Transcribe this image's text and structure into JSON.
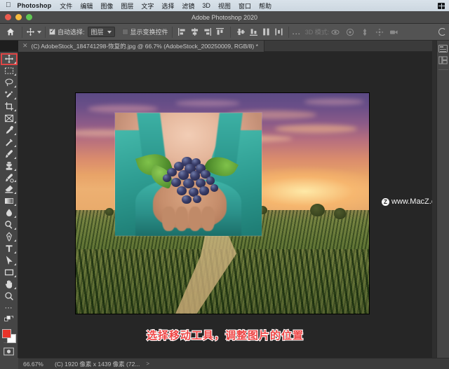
{
  "menubar": {
    "apple_icon": "apple-icon",
    "app_name": "Photoshop",
    "items": [
      "文件",
      "编辑",
      "图像",
      "图层",
      "文字",
      "选择",
      "滤镜",
      "3D",
      "视图",
      "窗口",
      "帮助"
    ],
    "right_icon": "grid-icon"
  },
  "window": {
    "title": "Adobe Photoshop 2020",
    "close": "close-button",
    "minimize": "minimize-button",
    "zoom": "zoom-button"
  },
  "options_bar": {
    "home_icon": "home-icon",
    "active_tool_icon": "move-tool-icon",
    "tool_preset_caret": "chevron-down-icon",
    "auto_select_checked": true,
    "auto_select_label": "自动选择:",
    "auto_select_value": "图层",
    "show_transform_checked": false,
    "show_transform_label": "显示变换控件",
    "align_icons": [
      "align-left-edges-icon",
      "align-horizontal-centers-icon",
      "align-right-edges-icon",
      "align-top-edges-icon",
      "align-vertical-centers-icon",
      "align-bottom-edges-icon",
      "distribute-top-icon",
      "distribute-vertical-centers-icon",
      "distribute-bottom-icon",
      "distribute-spacing-icon"
    ],
    "more_label": "...",
    "three_d_label": "3D 模式:",
    "three_d_icons": [
      "orbit-3d-icon",
      "roll-3d-icon",
      "drag-3d-icon",
      "slide-3d-icon",
      "camera-3d-icon"
    ],
    "right_icon": "workspace-icon"
  },
  "document_tab": {
    "close_icon": "close-tab-icon",
    "title": "(C) AdobeStock_184741298-恢复的.jpg @ 66.7% (AdobeStock_200250009, RGB/8) *"
  },
  "toolbar": {
    "selected_index": 0,
    "tools": [
      {
        "name": "move-tool",
        "selected": true
      },
      {
        "name": "rectangular-marquee-tool",
        "selected": false
      },
      {
        "name": "lasso-tool",
        "selected": false
      },
      {
        "name": "quick-selection-tool",
        "selected": false
      },
      {
        "name": "crop-tool",
        "selected": false
      },
      {
        "name": "frame-tool",
        "selected": false
      },
      {
        "name": "eyedropper-tool",
        "selected": false
      },
      {
        "name": "spot-healing-brush-tool",
        "selected": false
      },
      {
        "name": "brush-tool",
        "selected": false
      },
      {
        "name": "clone-stamp-tool",
        "selected": false
      },
      {
        "name": "history-brush-tool",
        "selected": false
      },
      {
        "name": "eraser-tool",
        "selected": false
      },
      {
        "name": "gradient-tool",
        "selected": false
      },
      {
        "name": "blur-tool",
        "selected": false
      },
      {
        "name": "dodge-tool",
        "selected": false
      },
      {
        "name": "pen-tool",
        "selected": false
      },
      {
        "name": "type-tool",
        "selected": false
      },
      {
        "name": "path-selection-tool",
        "selected": false
      },
      {
        "name": "rectangle-tool",
        "selected": false
      },
      {
        "name": "hand-tool",
        "selected": false
      },
      {
        "name": "zoom-tool",
        "selected": false
      },
      {
        "name": "edit-toolbar-tool",
        "selected": false
      }
    ],
    "foreground_color": "#e8342a",
    "background_color": "#ffffff",
    "quick_mask_icon": "quick-mask-icon",
    "screen_mode_icon": "screen-mode-icon"
  },
  "canvas": {
    "annotation_text": "选择移动工具，调整图片的位置",
    "annotation_color": "#ee4444",
    "annotation_outline_color": "#ffffff",
    "watermark_text": "www.MacZ.com",
    "watermark_badge": "Z",
    "background_layer_name": "vineyard-sunset-photo",
    "foreground_layer_name": "hands-holding-grapes-photo"
  },
  "right_rail": {
    "icons": [
      "properties-panel-icon",
      "layers-panel-icon"
    ]
  },
  "status_bar": {
    "zoom_level": "66.67%",
    "doc_info": "(C) 1920 像素 x 1439 像素 (72...",
    "chevron": ">"
  }
}
